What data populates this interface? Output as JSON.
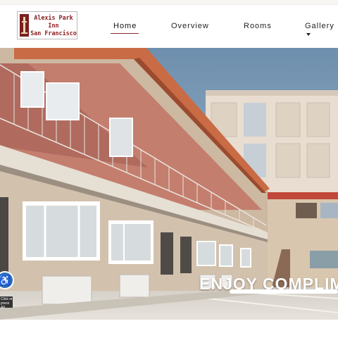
{
  "brand": {
    "name_line1": "Alexis Park",
    "name_line2": "Inn",
    "name_line3": "San Francisco",
    "color": "#8b1c1c"
  },
  "nav": {
    "items": [
      {
        "label": "Home",
        "active": true
      },
      {
        "label": "Overview"
      },
      {
        "label": "Rooms"
      },
      {
        "label": "Gallery"
      }
    ],
    "accent": "#8b2c2c"
  },
  "hero": {
    "caption": "ENJOY COMPLIM",
    "slide_progress": 1.0
  },
  "accessibility": {
    "icon": "wheelchair-icon",
    "label": "Click or press Alt"
  }
}
